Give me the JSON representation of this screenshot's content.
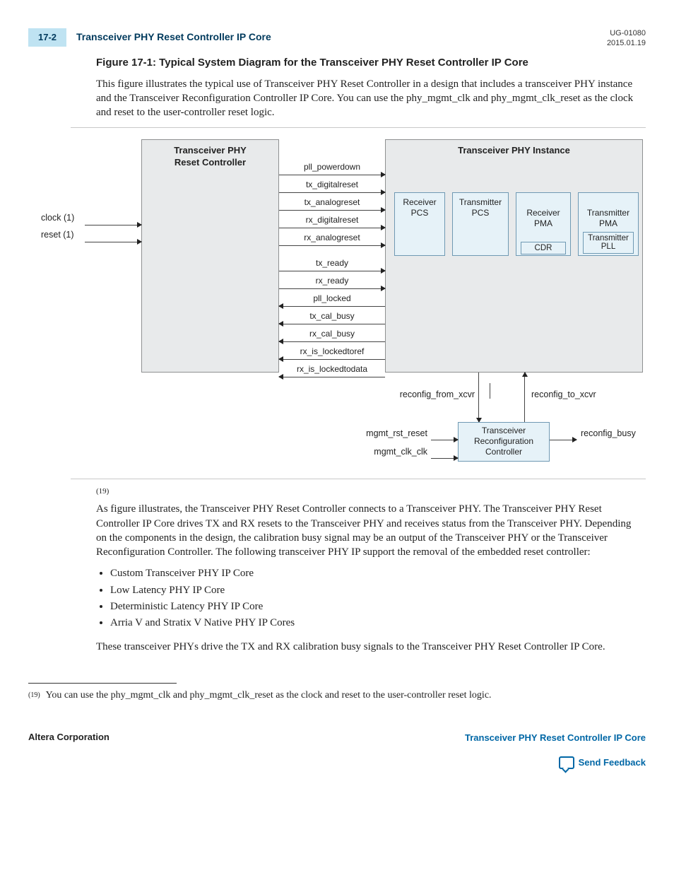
{
  "header": {
    "page_num": "17-2",
    "title": "Transceiver PHY Reset Controller IP Core",
    "doc_id": "UG-01080",
    "date": "2015.01.19"
  },
  "figure": {
    "caption": "Figure 17-1: Typical System Diagram for the Transceiver PHY Reset Controller IP Core",
    "intro": "This figure illustrates the typical use of Transceiver PHY Reset Controller in a design that includes a transceiver PHY instance and the Transceiver Reconfiguration Controller IP Core. You can use the phy_mgmt_clk and phy_mgmt_clk_reset as the clock and reset to the user-controller reset logic."
  },
  "diagram": {
    "left_block_title": "Transceiver PHY\nReset Controller",
    "right_block_title": "Transceiver PHY Instance",
    "inputs": {
      "clock": "clock  (1)",
      "reset": "reset  (1)"
    },
    "signals": [
      {
        "name": "pll_powerdown",
        "dir": "r"
      },
      {
        "name": "tx_digitalreset",
        "dir": "r"
      },
      {
        "name": "tx_analogreset",
        "dir": "r"
      },
      {
        "name": "rx_digitalreset",
        "dir": "r"
      },
      {
        "name": "rx_analogreset",
        "dir": "r"
      },
      {
        "name": "tx_ready",
        "dir": "r"
      },
      {
        "name": "rx_ready",
        "dir": "r"
      },
      {
        "name": "pll_locked",
        "dir": "l"
      },
      {
        "name": "tx_cal_busy",
        "dir": "l"
      },
      {
        "name": "rx_cal_busy",
        "dir": "l"
      },
      {
        "name": "rx_is_lockedtoref",
        "dir": "l"
      },
      {
        "name": "rx_is_lockedtodata",
        "dir": "l"
      }
    ],
    "minis": {
      "rx_pcs": "Receiver\nPCS",
      "tx_pcs": "Transmitter\nPCS",
      "rx_pma": "Receiver\nPMA",
      "rx_pma_inner": "CDR",
      "tx_pma": "Transmitter\nPMA",
      "tx_pma_inner": "Transmitter\nPLL"
    },
    "recfg": {
      "from": "reconfig_from_xcvr",
      "to": "reconfig_to_xcvr",
      "title": "Transceiver\nReconfiguration\nController",
      "mgmt_rst": "mgmt_rst_reset",
      "mgmt_clk": "mgmt_clk_clk",
      "busy": "reconfig_busy"
    }
  },
  "fn_ref": "(19)",
  "para2": "As figure illustrates, the Transceiver PHY Reset Controller connects to a Transceiver PHY. The Transceiver PHY Reset Controller IP Core drives TX and RX resets to the Transceiver PHY and receives status from the Transceiver PHY. Depending on the components in the design, the calibration busy signal may be an output of the Transceiver PHY or the Transceiver Reconfiguration Controller. The following transceiver PHY IP support the removal of the embedded reset controller:",
  "bullets": [
    "Custom Transceiver PHY IP Core",
    "Low Latency PHY IP Core",
    "Deterministic Latency PHY IP Core",
    "Arria V and Stratix V Native PHY IP Cores"
  ],
  "para3": "These transceiver PHYs drive the TX and RX calibration busy signals to the Transceiver PHY Reset Controller IP Core.",
  "footnote": {
    "num": "(19)",
    "text": "You can use the phy_mgmt_clk and phy_mgmt_clk_reset as the clock and reset to the user-controller reset logic."
  },
  "footer": {
    "company": "Altera Corporation",
    "chapter_link": "Transceiver PHY Reset Controller IP Core",
    "feedback": "Send Feedback"
  }
}
